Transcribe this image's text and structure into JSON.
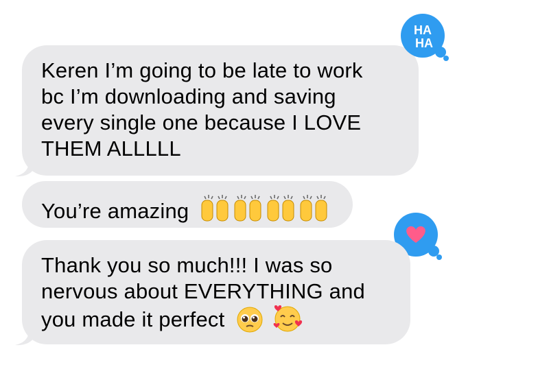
{
  "messages": [
    {
      "text": "Keren I’m going to be late to work\nbc I’m downloading and saving\nevery single one because I LOVE\nTHEM ALLLLL",
      "reaction": {
        "icon": "haha-reaction-icon",
        "label": "HA\nHA",
        "color": "#2f9cf0"
      }
    },
    {
      "text": "You’re amazing",
      "emojis": [
        "raising-hands-emoji",
        "raising-hands-emoji",
        "raising-hands-emoji",
        "raising-hands-emoji"
      ]
    },
    {
      "text": "Thank you so much!!! I was so\nnervous about EVERYTHING and\nyou made it perfect",
      "emojis": [
        "pleading-face-emoji",
        "smiling-face-with-hearts-emoji"
      ],
      "reaction": {
        "icon": "heart-reaction-icon",
        "color": "#2f9cf0",
        "heart_color": "#ff5c8a"
      }
    }
  ],
  "colors": {
    "received_bubble": "#e9e9eb",
    "reaction_badge": "#2f9cf0",
    "heart": "#ff5c8a"
  }
}
